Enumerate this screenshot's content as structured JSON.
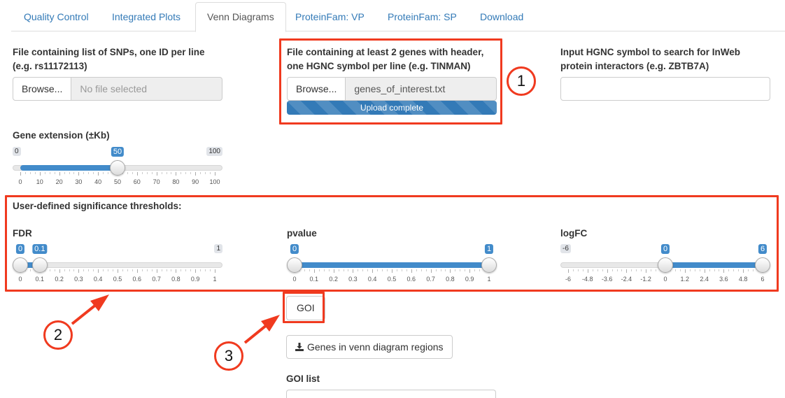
{
  "tabs": [
    {
      "label": "Quality Control"
    },
    {
      "label": "Integrated Plots"
    },
    {
      "label": "Venn Diagrams"
    },
    {
      "label": "ProteinFam: VP"
    },
    {
      "label": "ProteinFam: SP"
    },
    {
      "label": "Download"
    }
  ],
  "snp_file": {
    "label_line1": "File containing list of SNPs, one ID per line",
    "label_line2": "(e.g. rs11172113)",
    "browse": "Browse...",
    "filename": "No file selected"
  },
  "genes_file": {
    "label_line1": "File containing at least 2 genes with header,",
    "label_line2": "one HGNC symbol per line (e.g. TINMAN)",
    "browse": "Browse...",
    "filename": "genes_of_interest.txt",
    "progress_text": "Upload complete",
    "progress_fraction": 1.0
  },
  "hgnc_input": {
    "label_line1": "Input HGNC symbol to search for InWeb",
    "label_line2": "protein interactors (e.g. ZBTB7A)",
    "value": ""
  },
  "gene_ext": {
    "label": "Gene extension (±Kb)",
    "min": 0,
    "max": 100,
    "value": 50,
    "min_label": "0",
    "max_label": "100",
    "value_label": "50",
    "ticks": [
      "0",
      "10",
      "20",
      "30",
      "40",
      "50",
      "60",
      "70",
      "80",
      "90",
      "100"
    ]
  },
  "thresholds": {
    "heading": "User-defined significance thresholds:",
    "fdr": {
      "label": "FDR",
      "min": 0,
      "max": 1,
      "from": 0,
      "to": 0.1,
      "from_label": "0",
      "to_label": "0.1",
      "max_label": "1",
      "ticks": [
        "0",
        "0.1",
        "0.2",
        "0.3",
        "0.4",
        "0.5",
        "0.6",
        "0.7",
        "0.8",
        "0.9",
        "1"
      ]
    },
    "pvalue": {
      "label": "pvalue",
      "min": 0,
      "max": 1,
      "from": 0,
      "to": 1,
      "from_label": "0",
      "to_label": "1",
      "ticks": [
        "0",
        "0.1",
        "0.2",
        "0.3",
        "0.4",
        "0.5",
        "0.6",
        "0.7",
        "0.8",
        "0.9",
        "1"
      ]
    },
    "logfc": {
      "label": "logFC",
      "min": -6,
      "max": 6,
      "from": 0,
      "to": 6,
      "min_label": "-6",
      "from_label": "0",
      "to_label": "6",
      "ticks": [
        "-6",
        "-4.8",
        "-3.6",
        "-2.4",
        "-1.2",
        "0",
        "1.2",
        "2.4",
        "3.6",
        "4.8",
        "6"
      ]
    }
  },
  "goi_button": "GOI",
  "download_button": "Genes in venn diagram regions",
  "goi_list_label": "GOI list",
  "annotations": {
    "c1": "1",
    "c2": "2",
    "c3": "3"
  },
  "colors": {
    "highlight": "#f03a1f",
    "accent": "#428bca",
    "link": "#337ab7"
  }
}
